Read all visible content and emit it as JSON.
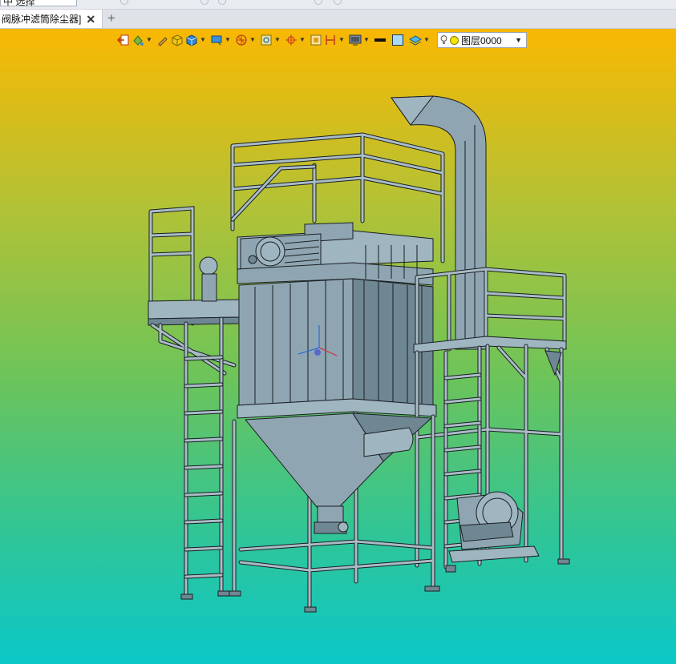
{
  "top_strip": {
    "filter_value": "中 选择"
  },
  "tabs": [
    {
      "label": "阀脉冲滤筒除尘器]",
      "active": true,
      "close_glyph": "✕"
    }
  ],
  "tab_add_glyph": "+",
  "toolbar": {
    "layer_selector": {
      "value": "图层0000",
      "color": "#f5e400"
    }
  },
  "viewport": {
    "background_gradient": [
      "#f9b802",
      "#6cc45a",
      "#0bc8c8"
    ],
    "model_color": "#8fa6b2",
    "model_edge_color": "#1a1f24"
  }
}
